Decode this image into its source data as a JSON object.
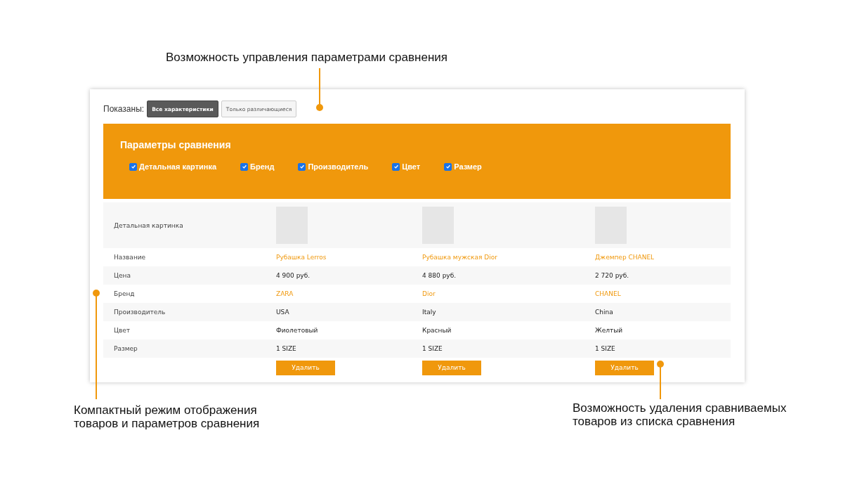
{
  "annotations": {
    "top": "Возможность управления параметрами сравнения",
    "left": "Компактный режим отображения\nтоваров и параметров сравнения",
    "right": "Возможность удаления сравниваемых\nтоваров из списка сравнения"
  },
  "filter": {
    "label": "Показаны:",
    "buttons": [
      {
        "label": "Все характеристики",
        "selected": true
      },
      {
        "label": "Только различающиеся",
        "selected": false
      }
    ]
  },
  "params_panel": {
    "title": "Параметры сравнения",
    "options": [
      {
        "label": "Детальная картинка",
        "checked": true
      },
      {
        "label": "Бренд",
        "checked": true
      },
      {
        "label": "Производитель",
        "checked": true
      },
      {
        "label": "Цвет",
        "checked": true
      },
      {
        "label": "Размер",
        "checked": true
      }
    ]
  },
  "table": {
    "rows": [
      {
        "label": "Детальная картинка",
        "kind": "image"
      },
      {
        "label": "Название",
        "kind": "link",
        "values": [
          "Рубашка Lerros",
          "Рубашка мужская Dior",
          "Джемпер CHANEL"
        ]
      },
      {
        "label": "Цена",
        "kind": "text",
        "values": [
          "4 900 руб.",
          "4 880 руб.",
          "2 720 руб."
        ]
      },
      {
        "label": "Бренд",
        "kind": "link",
        "values": [
          "ZARA",
          "Dior",
          "CHANEL"
        ]
      },
      {
        "label": "Производитель",
        "kind": "text",
        "values": [
          "USA",
          "Italy",
          "China"
        ]
      },
      {
        "label": "Цвет",
        "kind": "text",
        "values": [
          "Фиолетовый",
          "Красный",
          "Желтый"
        ]
      },
      {
        "label": "Размер",
        "kind": "text",
        "values": [
          "1 SIZE",
          "1 SIZE",
          "1 SIZE"
        ]
      }
    ],
    "delete_buttons": [
      "Удалить",
      "Удалить",
      "Удалить"
    ]
  }
}
